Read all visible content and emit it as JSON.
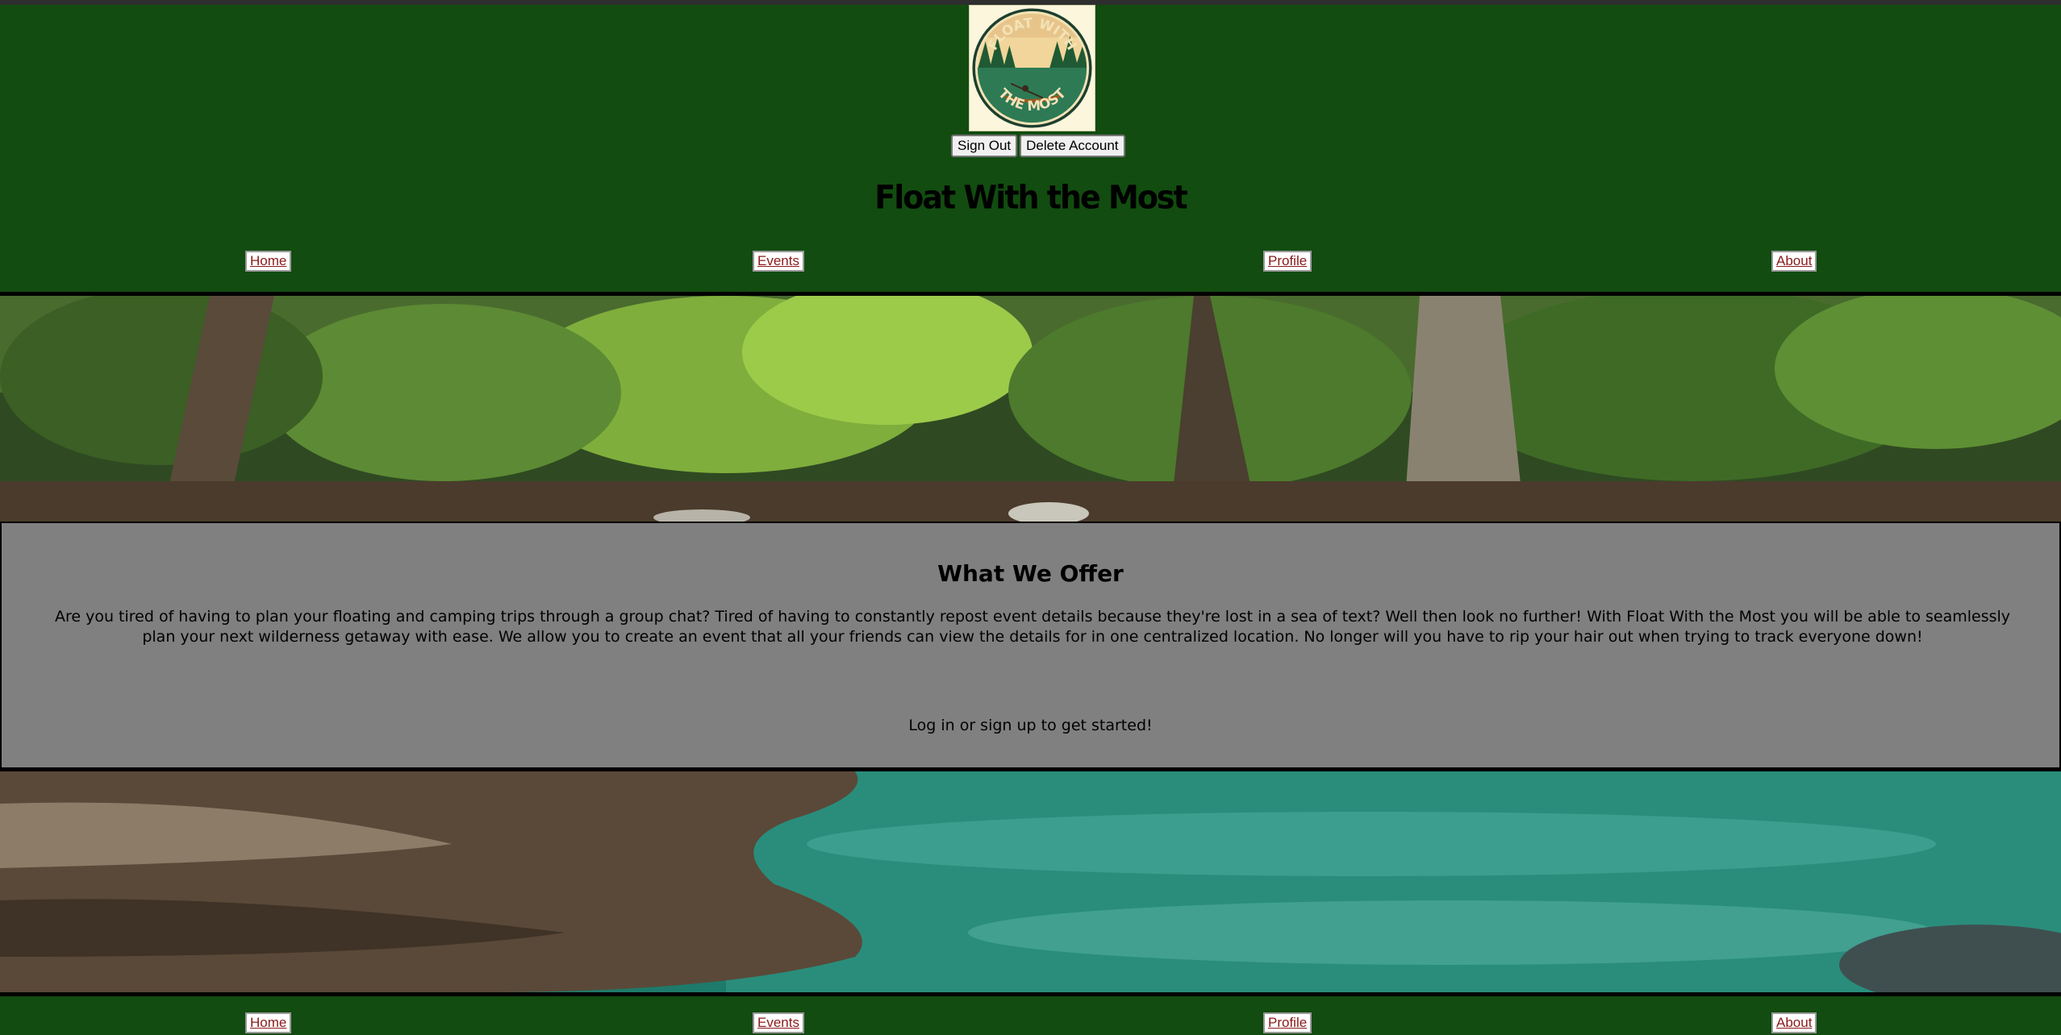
{
  "logo": {
    "text_top": "FLOAT WITH",
    "text_bottom": "THE MOST",
    "icon": "kayak-logo"
  },
  "auth": {
    "sign_out_label": "Sign Out",
    "delete_account_label": "Delete Account"
  },
  "site_title": "Float With the Most",
  "nav": {
    "items": [
      {
        "label": "Home"
      },
      {
        "label": "Events"
      },
      {
        "label": "Profile"
      },
      {
        "label": "About"
      }
    ]
  },
  "offer": {
    "heading": "What We Offer",
    "description": "Are you tired of having to plan your floating and camping trips through a group chat? Tired of having to constantly repost event details because they're lost in a sea of text? Well then look no further! With Float With the Most you will be able to seamlessly plan your next wilderness getaway with ease. We allow you to create an event that all your friends can view the details for in one centralized location. No longer will you have to rip your hair out when trying to track everyone down!",
    "cta": "Log in or sign up to get started!"
  },
  "colors": {
    "header_bg": "#124c10",
    "panel_bg": "#808080",
    "link": "#8b1a1a"
  }
}
